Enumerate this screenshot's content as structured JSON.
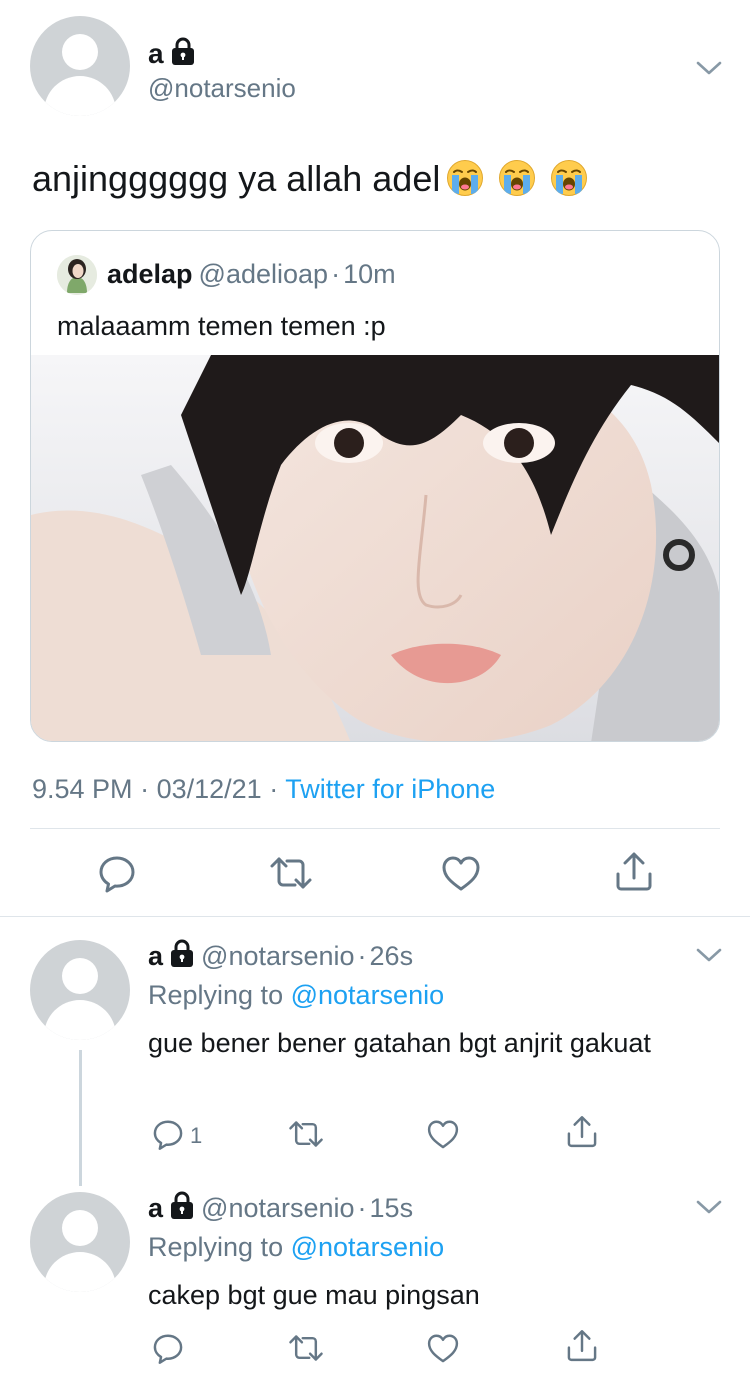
{
  "main_tweet": {
    "name": "a",
    "handle": "@notarsenio",
    "text": "anjingggggg ya allah adel",
    "emoji": "loudly-crying-face x3",
    "quote": {
      "name": "adelap",
      "handle": "@adelioap",
      "time": "10m",
      "text": "malaaamm temen temen :p"
    },
    "time": "9.54 PM",
    "date": "03/12/21",
    "source": "Twitter for iPhone"
  },
  "replies": [
    {
      "name": "a",
      "handle": "@notarsenio",
      "time": "26s",
      "replying_label": "Replying to",
      "replying_to": "@notarsenio",
      "text": "gue bener bener gatahan bgt anjrit gakuat",
      "reply_count": "1"
    },
    {
      "name": "a",
      "handle": "@notarsenio",
      "time": "15s",
      "replying_label": "Replying to",
      "replying_to": "@notarsenio",
      "text": "cakep bgt gue mau pingsan"
    }
  ],
  "separator": "·",
  "icons": {
    "reply": "reply-icon",
    "retweet": "retweet-icon",
    "like": "like-icon",
    "share": "share-icon",
    "lock": "lock-icon",
    "menu": "chevron-down-icon"
  },
  "colors": {
    "link": "#1da1f2",
    "secondary_text": "#657786",
    "icon": "#657786",
    "border": "#ccd6dd"
  }
}
